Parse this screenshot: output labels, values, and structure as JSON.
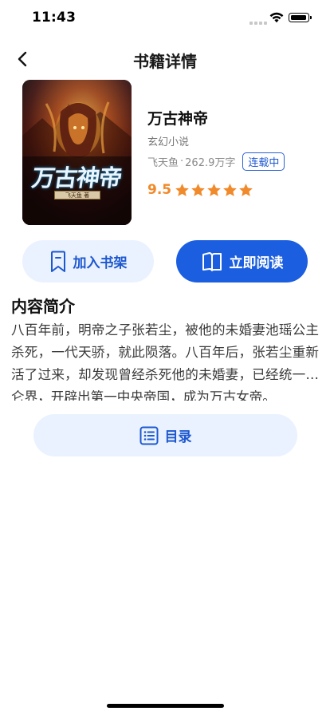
{
  "status_bar": {
    "time": "11:43"
  },
  "nav": {
    "title": "书籍详情",
    "back_icon": "chevron-left-icon"
  },
  "book": {
    "cover_title": "万古神帝",
    "cover_author_tag": "飞天鱼 著",
    "title": "万古神帝",
    "category": "玄幻小说",
    "author": "飞天鱼",
    "separator": "·",
    "word_count": "262.9万字",
    "status": "连载中",
    "rating": "9.5",
    "stars": 5
  },
  "actions": {
    "add_shelf_label": "加入书架",
    "add_shelf_icon": "bookmark-icon",
    "read_now_label": "立即阅读",
    "read_now_icon": "open-book-icon",
    "catalog_label": "目录",
    "catalog_icon": "list-icon"
  },
  "synopsis": {
    "heading": "内容简介",
    "text": "八百年前，明帝之子张若尘，被他的未婚妻池瑶公主杀死，一代天骄，就此陨落。八百年后，张若尘重新活了过来，却发现曾经杀死他的未婚妻，已经统一昆仑界，开辟出第一中央帝国，成为万古女帝。"
  },
  "colors": {
    "accent": "#1b5ee0",
    "accent_light": "#eaf2ff",
    "rating": "#f08a2b"
  }
}
